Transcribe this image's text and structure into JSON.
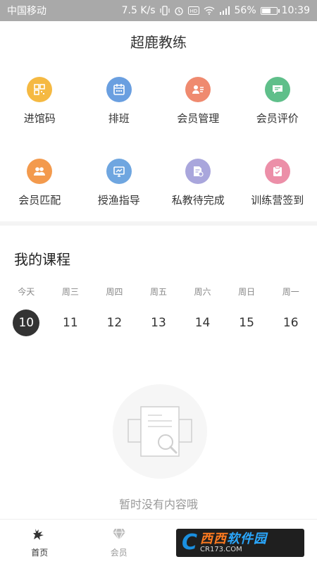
{
  "status_bar": {
    "carrier": "中国移动",
    "speed": "7.5 K/s",
    "battery": "56%",
    "battery_level": 0.56,
    "time": "10:39"
  },
  "header": {
    "title": "超鹿教练"
  },
  "grid": [
    {
      "label": "进馆码",
      "icon": "qr-code-icon",
      "color": "#f5b942"
    },
    {
      "label": "排班",
      "icon": "calendar-icon",
      "color": "#6a9fe0"
    },
    {
      "label": "会员管理",
      "icon": "member-list-icon",
      "color": "#ef8a6f"
    },
    {
      "label": "会员评价",
      "icon": "comment-icon",
      "color": "#5fbf8a"
    },
    {
      "label": "会员匹配",
      "icon": "members-match-icon",
      "color": "#f39a4d"
    },
    {
      "label": "授渔指导",
      "icon": "guide-board-icon",
      "color": "#6fa6e0"
    },
    {
      "label": "私教待完成",
      "icon": "pending-doc-icon",
      "color": "#a9a6dc"
    },
    {
      "label": "训练营签到",
      "icon": "check-in-icon",
      "color": "#ec8fa8"
    }
  ],
  "courses": {
    "title": "我的课程",
    "days": [
      {
        "label": "今天",
        "num": "10"
      },
      {
        "label": "周三",
        "num": "11"
      },
      {
        "label": "周四",
        "num": "12"
      },
      {
        "label": "周五",
        "num": "13"
      },
      {
        "label": "周六",
        "num": "14"
      },
      {
        "label": "周日",
        "num": "15"
      },
      {
        "label": "周一",
        "num": "16"
      }
    ],
    "selected_index": 0,
    "empty_text": "暂时没有内容哦"
  },
  "bottom_nav": [
    {
      "label": "首页",
      "icon": "deer-home-icon",
      "active": true
    },
    {
      "label": "会员",
      "icon": "diamond-icon",
      "active": false
    },
    {
      "label": "",
      "icon": "",
      "active": false
    },
    {
      "label": "",
      "icon": "",
      "active": false
    }
  ],
  "watermark": {
    "t1a": "西西",
    "t1b": "软件园",
    "t2": "CR173.COM"
  },
  "colors": {
    "selected_day": "#333333",
    "muted_text": "#999999"
  }
}
